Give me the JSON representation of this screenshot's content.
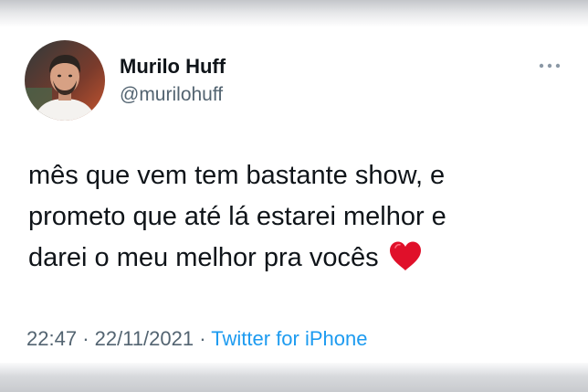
{
  "tweet": {
    "author_name": "Murilo Huff",
    "author_handle": "@murilohuff",
    "text_lines": [
      "mês que vem tem bastante show, e",
      "prometo que até lá estarei melhor e",
      "darei o meu melhor pra vocês"
    ],
    "emoji": "heart-emoji",
    "time": "22:47",
    "date": "22/11/2021",
    "separator": "·",
    "source": "Twitter for iPhone"
  },
  "colors": {
    "text_primary": "#0f1419",
    "text_secondary": "#536471",
    "link": "#1d9bf0",
    "heart": "#e0102a"
  },
  "icons": {
    "more": "more-options-icon"
  }
}
